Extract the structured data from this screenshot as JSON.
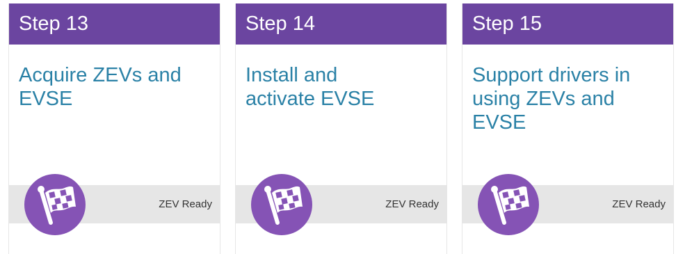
{
  "cards": [
    {
      "step": "Step 13",
      "title_lines": [
        "Acquire ZEVs and",
        "EVSE"
      ],
      "badge_label": "ZEV Ready",
      "badge_icon": "checkered-flag-icon"
    },
    {
      "step": "Step 14",
      "title_lines": [
        "Install and",
        "activate EVSE"
      ],
      "badge_label": "ZEV Ready",
      "badge_icon": "checkered-flag-icon"
    },
    {
      "step": "Step 15",
      "title_lines": [
        "Support drivers in",
        "using ZEVs and",
        "EVSE"
      ],
      "badge_label": "ZEV Ready",
      "badge_icon": "checkered-flag-icon"
    }
  ],
  "colors": {
    "header_bg": "#6b45a0",
    "header_text": "#ffffff",
    "title_text": "#2a81a6",
    "footer_bg": "#e6e6e6",
    "badge_bg": "#8553b5"
  }
}
